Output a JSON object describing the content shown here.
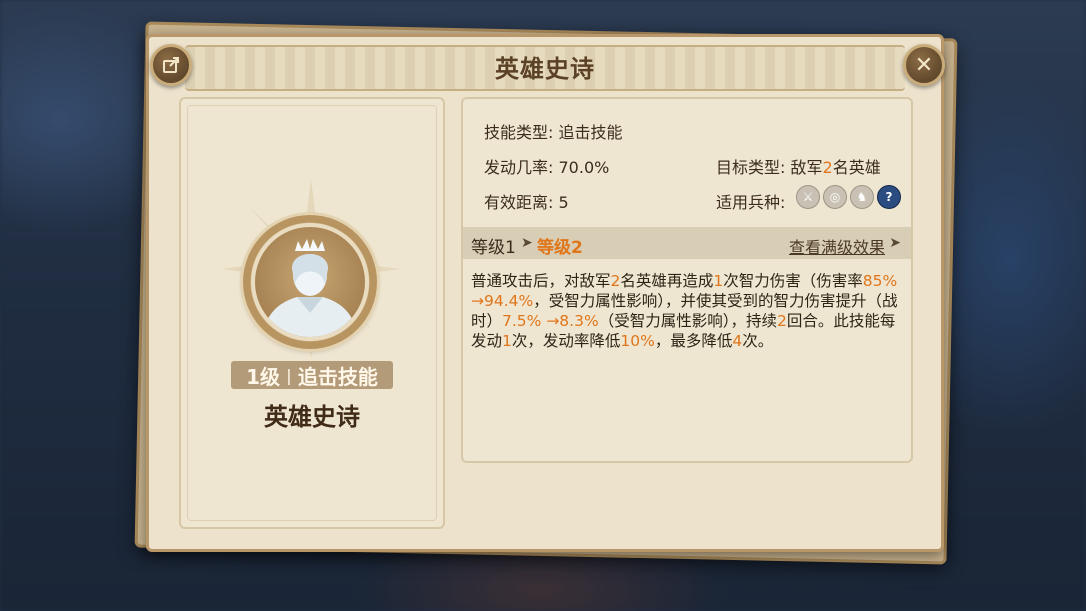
{
  "title": "英雄史诗",
  "skill": {
    "level_label": "1级",
    "type_label": "追击技能",
    "name": "英雄史诗"
  },
  "info": {
    "skill_type_key": "技能类型:",
    "skill_type_value": "追击技能",
    "trigger_rate_key": "发动几率:",
    "trigger_rate_value": "70.0%",
    "target_type_key": "目标类型:",
    "target_prefix": "敌军",
    "target_count": "2",
    "target_suffix": "名英雄",
    "range_key": "有效距离:",
    "range_value": "5",
    "unit_types_key": "适用兵种:",
    "unit_icons": [
      "sword-icon",
      "target-icon",
      "horse-icon",
      "help-icon"
    ]
  },
  "levels": {
    "current": "等级1",
    "next": "等级2",
    "view_max": "查看满级效果"
  },
  "description": [
    {
      "t": "普通攻击后，对敌军"
    },
    {
      "t": "2",
      "hl": true
    },
    {
      "t": "名英雄再造成"
    },
    {
      "t": "1",
      "hl": true
    },
    {
      "t": "次智力伤害（伤害率"
    },
    {
      "t": "85% →94.4%",
      "hl": true
    },
    {
      "t": "，受智力属性影响），并使其受到的智力伤害提升（战时）"
    },
    {
      "t": "7.5% →8.3%",
      "hl": true
    },
    {
      "t": "（受智力属性影响），持续"
    },
    {
      "t": "2",
      "hl": true
    },
    {
      "t": "回合。此技能每发动"
    },
    {
      "t": "1",
      "hl": true
    },
    {
      "t": "次，发动率降低"
    },
    {
      "t": "10%",
      "hl": true
    },
    {
      "t": "，最多降低"
    },
    {
      "t": "4",
      "hl": true
    },
    {
      "t": "次。"
    }
  ],
  "colors": {
    "highlight": "#e0761b",
    "panel": "#ede3cd",
    "title": "#5b4226"
  }
}
